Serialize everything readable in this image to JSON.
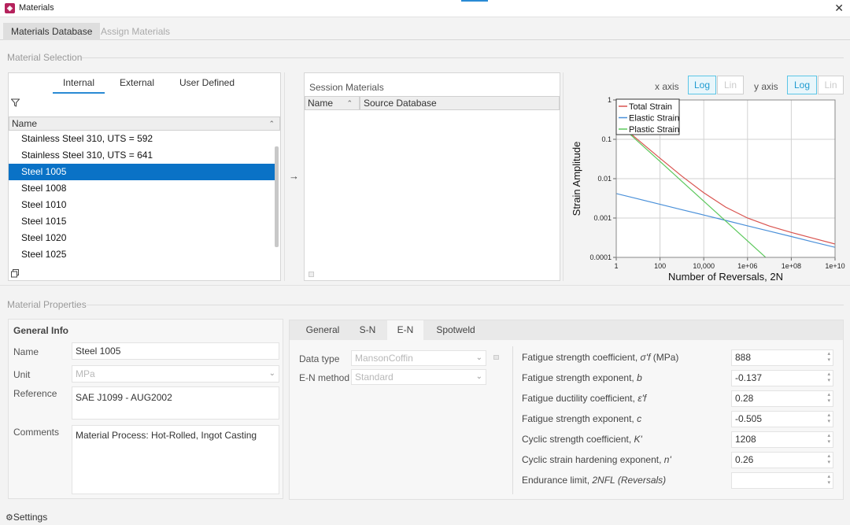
{
  "window": {
    "title": "Materials",
    "app_icon": "app-logo-icon",
    "close_glyph": "✕"
  },
  "main_tabs": [
    {
      "label": "Materials Database",
      "active": true
    },
    {
      "label": "Assign Materials",
      "active": false
    }
  ],
  "material_selection": {
    "label": "Material Selection",
    "source_tabs": [
      {
        "label": "Internal",
        "active": true
      },
      {
        "label": "External",
        "active": false
      },
      {
        "label": "User Defined",
        "active": false
      }
    ],
    "name_header": "Name",
    "items": [
      {
        "label": "Stainless Steel 310, UTS = 592",
        "selected": false
      },
      {
        "label": "Stainless Steel 310, UTS = 641",
        "selected": false
      },
      {
        "label": "Steel 1005",
        "selected": true
      },
      {
        "label": "Steel 1008",
        "selected": false
      },
      {
        "label": "Steel 1010",
        "selected": false
      },
      {
        "label": "Steel 1015",
        "selected": false
      },
      {
        "label": "Steel 1020",
        "selected": false
      },
      {
        "label": "Steel 1025",
        "selected": false
      }
    ],
    "transfer_glyph": "→"
  },
  "session_materials": {
    "title": "Session Materials",
    "columns": [
      "Name",
      "Source Database"
    ]
  },
  "axis_toggles": {
    "x_label": "x axis",
    "y_label": "y axis",
    "log": "Log",
    "lin": "Lin"
  },
  "chart_data": {
    "type": "line",
    "xlabel": "Number of Reversals, 2N",
    "ylabel": "Strain Amplitude",
    "xscale": "log",
    "yscale": "log",
    "xlim": [
      1,
      10000000000
    ],
    "ylim": [
      0.0001,
      1
    ],
    "x_ticks": [
      "1",
      "100",
      "10,000",
      "1e+06",
      "1e+08",
      "1e+10"
    ],
    "y_ticks": [
      "1",
      "0.1",
      "0.01",
      "0.001",
      "0.0001"
    ],
    "grid": true,
    "legend_position": "top-left",
    "series": [
      {
        "name": "Total Strain",
        "color": "#d9534f",
        "x": [
          1,
          10,
          100,
          1000,
          10000,
          100000,
          1000000,
          10000000,
          100000000,
          1000000000,
          10000000000
        ],
        "y": [
          0.284,
          0.0965,
          0.033,
          0.0116,
          0.00438,
          0.0019,
          0.001,
          0.000625,
          0.00043,
          0.000306,
          0.000219
        ]
      },
      {
        "name": "Elastic Strain",
        "color": "#4a90d9",
        "x": [
          1,
          10,
          100,
          1000,
          10000,
          100000,
          1000000,
          10000000,
          100000000,
          1000000000,
          10000000000
        ],
        "y": [
          0.00419,
          0.00306,
          0.00223,
          0.00163,
          0.00119,
          0.00087,
          0.000635,
          0.000464,
          0.000339,
          0.000247,
          0.00018
        ]
      },
      {
        "name": "Plastic Strain",
        "color": "#5cc85c",
        "x": [
          1,
          10,
          100,
          1000,
          10000,
          100000,
          1000000,
          10000000
        ],
        "y": [
          0.28,
          0.0876,
          0.0274,
          0.00857,
          0.00268,
          0.000838,
          0.000262,
          8.2e-05
        ]
      }
    ]
  },
  "material_properties": {
    "label": "Material Properties",
    "general": {
      "heading": "General Info",
      "name_label": "Name",
      "name_value": "Steel 1005",
      "unit_label": "Unit",
      "unit_value": "MPa",
      "reference_label": "Reference",
      "reference_value": "SAE J1099 - AUG2002",
      "comments_label": "Comments",
      "comments_value": "Material Process: Hot-Rolled, Ingot Casting"
    },
    "tabs": [
      {
        "label": "General",
        "active": false
      },
      {
        "label": "S-N",
        "active": false
      },
      {
        "label": "E-N",
        "active": true
      },
      {
        "label": "Spotweld",
        "active": false
      }
    ],
    "data_type_label": "Data type",
    "data_type_value": "MansonCoffin",
    "en_method_label": "E-N method",
    "en_method_value": "Standard",
    "params": [
      {
        "label": "Fatigue strength coefficient, ",
        "sym": "σ'f",
        "unit": " (MPa)",
        "value": "888"
      },
      {
        "label": "Fatigue strength exponent, ",
        "sym": "b",
        "unit": "",
        "value": "-0.137"
      },
      {
        "label": "Fatigue ductility coefficient, ",
        "sym": "ε'f",
        "unit": "",
        "value": "0.28"
      },
      {
        "label": "Fatigue strength exponent, ",
        "sym": "c",
        "unit": "",
        "value": "-0.505"
      },
      {
        "label": "Cyclic strength coefficient, ",
        "sym": "K'",
        "unit": "",
        "value": "1208"
      },
      {
        "label": "Cyclic strain hardening exponent, ",
        "sym": "n'",
        "unit": "",
        "value": "0.26"
      },
      {
        "label": "Endurance limit, ",
        "sym": "2NFL (Reversals)",
        "unit": "",
        "value": ""
      }
    ]
  },
  "footer": {
    "settings_label": "Settings"
  }
}
